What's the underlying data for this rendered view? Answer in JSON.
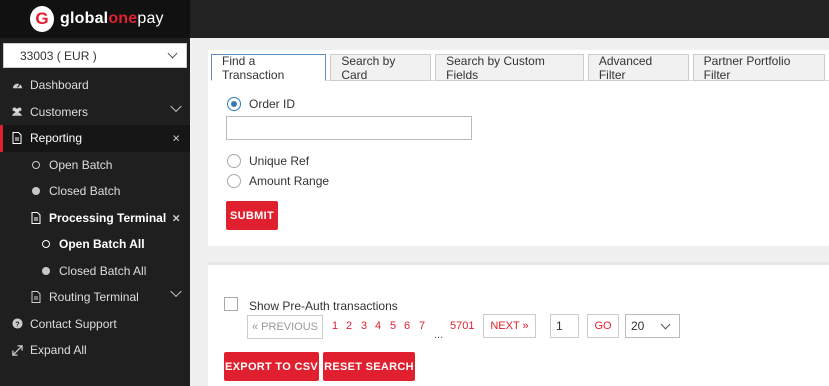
{
  "brand": {
    "initial": "G",
    "name_part1": "global",
    "name_part2": "one",
    "name_part3": "pay"
  },
  "account": {
    "selected": "33003 ( EUR )"
  },
  "sidebar": {
    "items": [
      {
        "label": "Dashboard"
      },
      {
        "label": "Customers"
      },
      {
        "label": "Reporting",
        "close": "×"
      },
      {
        "label": "Open Batch"
      },
      {
        "label": "Closed Batch"
      },
      {
        "label": "Processing Terminal",
        "close": "×"
      },
      {
        "label": "Open Batch All"
      },
      {
        "label": "Closed Batch All"
      },
      {
        "label": "Routing Terminal"
      },
      {
        "label": "Contact Support"
      },
      {
        "label": "Expand All"
      }
    ]
  },
  "tabs": [
    {
      "label": "Find a Transaction"
    },
    {
      "label": "Search by Card"
    },
    {
      "label": "Search by Custom Fields"
    },
    {
      "label": "Advanced Filter"
    },
    {
      "label": "Partner Portfolio Filter"
    }
  ],
  "search": {
    "options": [
      {
        "label": "Order ID",
        "selected": true
      },
      {
        "label": "Unique Ref",
        "selected": false
      },
      {
        "label": "Amount Range",
        "selected": false
      }
    ],
    "input_value": "",
    "submit_label": "SUBMIT"
  },
  "results": {
    "preauth_label": "Show Pre-Auth transactions",
    "preauth_checked": false,
    "prev_label": "« PREVIOUS",
    "pages": [
      "1",
      "2",
      "3",
      "4",
      "5",
      "6",
      "7"
    ],
    "ellipsis": "...",
    "last_page": "5701",
    "next_label": "NEXT »",
    "page_input": "1",
    "go_label": "GO",
    "page_size": "20",
    "export_label": "EXPORT TO CSV",
    "reset_label": "RESET SEARCH"
  },
  "colors": {
    "accent": "#e0202e",
    "sidebar_bg": "#1f1f1f",
    "topbar_bg": "#222222",
    "radio_selected": "#337ab7"
  }
}
